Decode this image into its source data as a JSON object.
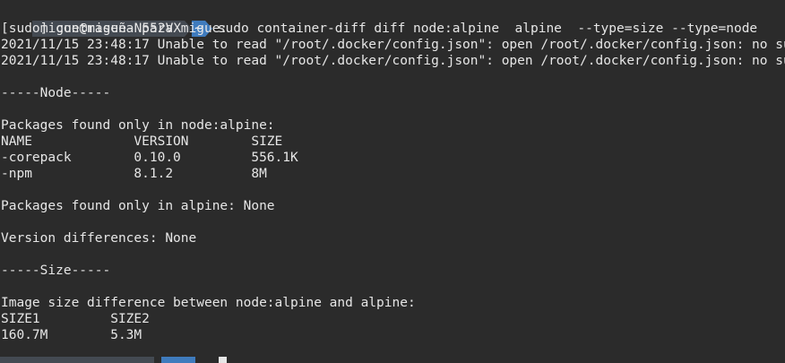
{
  "prompt": {
    "user_host": "migue@migue-N552VX",
    "dir": "~",
    "command": "sudo container-diff diff node:alpine  alpine  --type=size --type=node"
  },
  "lines": [
    "[sudo] contraseña para migue:",
    "2021/11/15 23:48:17 Unable to read \"/root/.docker/config.json\": open /root/.docker/config.json: no such file or directory",
    "2021/11/15 23:48:17 Unable to read \"/root/.docker/config.json\": open /root/.docker/config.json: no such file or directory",
    "",
    "-----Node-----",
    "",
    "Packages found only in node:alpine:",
    "NAME             VERSION        SIZE",
    "-corepack        0.10.0         556.1K",
    "-npm             8.1.2          8M",
    "",
    "Packages found only in alpine: None",
    "",
    "Version differences: None",
    "",
    "-----Size-----",
    "",
    "Image size difference between node:alpine and alpine:",
    "SIZE1         SIZE2",
    "160.7M        5.3M"
  ],
  "colors": {
    "background": "#2b2b2b",
    "foreground": "#e6e6e6",
    "prompt_dark": "#444a52",
    "prompt_blue": "#3f7bbd"
  }
}
